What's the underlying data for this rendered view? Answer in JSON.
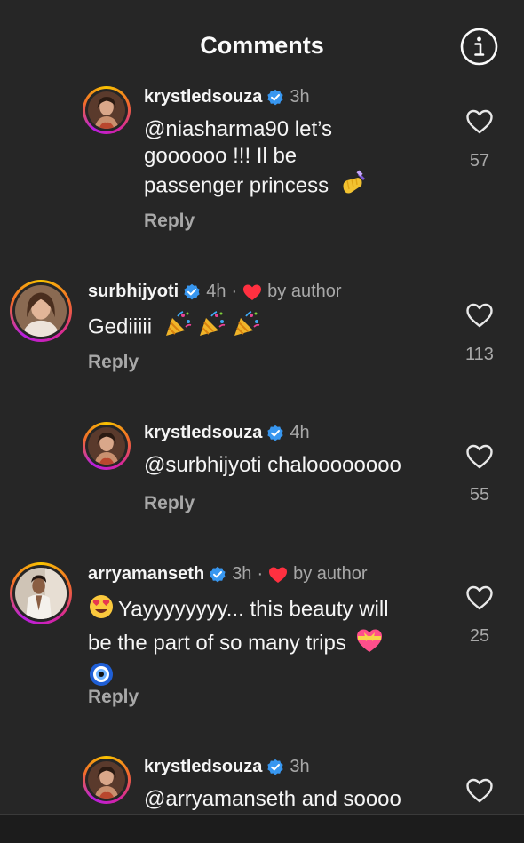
{
  "header": {
    "title": "Comments",
    "info_icon": "info-icon"
  },
  "comments": [
    {
      "username": "krystledsouza",
      "time": "3h",
      "text_lines": [
        "@niasharma90 let’s",
        "goooooo !!! Il be",
        "passenger princess"
      ],
      "reply_label": "Reply",
      "likes": "57"
    },
    {
      "username": "surbhijyoti",
      "time": "4h",
      "by_author": "by author",
      "text_lines": [
        "Gediiiii"
      ],
      "reply_label": "Reply",
      "likes": "113"
    },
    {
      "username": "krystledsouza",
      "time": "4h",
      "text_lines": [
        "@surbhijyoti chaloooooooo"
      ],
      "reply_label": "Reply",
      "likes": "55"
    },
    {
      "username": "arryamanseth",
      "time": "3h",
      "by_author": "by author",
      "text_lines": [
        "Yayyyyyyyy... this beauty will",
        "be the part of so many trips"
      ],
      "reply_label": "Reply",
      "likes": "25"
    },
    {
      "username": "krystledsouza",
      "time": "3h",
      "text_lines": [
        "@arryamanseth and soooo"
      ],
      "likes": ""
    }
  ],
  "colors": {
    "background": "#262626",
    "text": "#f5f5f5",
    "muted": "#a8a8a8",
    "verified": "#3897f0",
    "author_heart": "#ff3040"
  }
}
